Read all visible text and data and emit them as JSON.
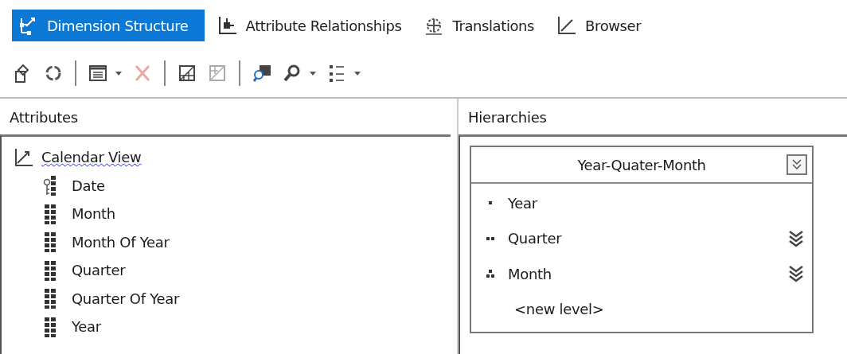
{
  "tabs": [
    {
      "label": "Dimension Structure",
      "selected": true
    },
    {
      "label": "Attribute Relationships",
      "selected": false
    },
    {
      "label": "Translations",
      "selected": false
    },
    {
      "label": "Browser",
      "selected": false
    }
  ],
  "toolbar": [
    {
      "kind": "button",
      "disabled": false,
      "dropdown": false
    },
    {
      "kind": "button",
      "disabled": false,
      "dropdown": false
    },
    {
      "kind": "separator"
    },
    {
      "kind": "button",
      "disabled": false,
      "dropdown": true
    },
    {
      "kind": "button",
      "disabled": true,
      "dropdown": false
    },
    {
      "kind": "separator"
    },
    {
      "kind": "button",
      "disabled": false,
      "dropdown": false
    },
    {
      "kind": "button",
      "disabled": true,
      "dropdown": false
    },
    {
      "kind": "separator"
    },
    {
      "kind": "button",
      "disabled": false,
      "dropdown": false
    },
    {
      "kind": "button",
      "disabled": false,
      "dropdown": true
    },
    {
      "kind": "button",
      "disabled": false,
      "dropdown": true
    }
  ],
  "attributes_pane": {
    "title": "Attributes",
    "dimension": {
      "name": "Calendar View",
      "misspelled": true,
      "children": [
        {
          "name": "Date",
          "kind": "key"
        },
        {
          "name": "Month",
          "kind": "attribute"
        },
        {
          "name": "Month Of Year",
          "kind": "attribute"
        },
        {
          "name": "Quarter",
          "kind": "attribute"
        },
        {
          "name": "Quarter Of Year",
          "kind": "attribute"
        },
        {
          "name": "Year",
          "kind": "attribute"
        }
      ]
    }
  },
  "hierarchies_pane": {
    "title": "Hierarchies",
    "hierarchies": [
      {
        "name": "Year-Quater-Month",
        "levels": [
          {
            "name": "Year",
            "kind": "one",
            "warning": false
          },
          {
            "name": "Quarter",
            "kind": "two",
            "warning": true
          },
          {
            "name": "Month",
            "kind": "three",
            "warning": true
          }
        ],
        "new_level": "<new level>"
      }
    ]
  }
}
